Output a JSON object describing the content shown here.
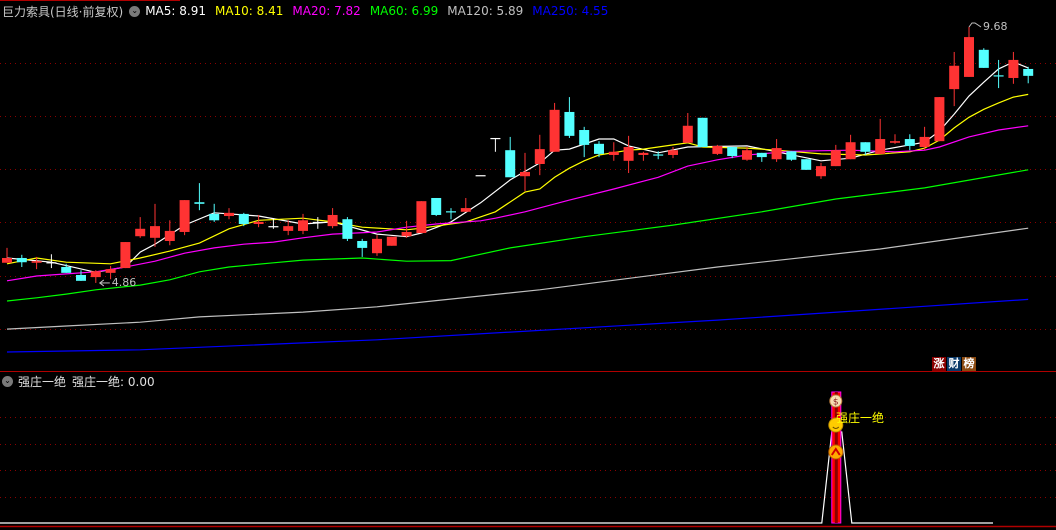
{
  "header": {
    "title": "巨力索具(日线·前复权)",
    "ma": [
      {
        "label": "MA5: 8.91",
        "color": "#ffffff"
      },
      {
        "label": "MA10: 8.41",
        "color": "#ffff00"
      },
      {
        "label": "MA20: 7.82",
        "color": "#ff00ff"
      },
      {
        "label": "MA60: 6.99",
        "color": "#00ff00"
      },
      {
        "label": "MA120: 5.89",
        "color": "#c0c0c0"
      },
      {
        "label": "MA250: 4.55",
        "color": "#0000ff"
      }
    ]
  },
  "markers": {
    "high_label": "9.68",
    "low_label": "4.86",
    "high_index": 65,
    "low_index": 6
  },
  "badges": [
    {
      "text": "涨",
      "color": "#8b0000"
    },
    {
      "text": "财",
      "color": "#0a3a6a"
    },
    {
      "text": "榜",
      "color": "#8b4a10"
    }
  ],
  "indicator": {
    "name": "强庄一绝",
    "value_label": "强庄一绝: 0.00",
    "signal_label": "强庄一绝",
    "signal_index": 56
  },
  "colors": {
    "up": "#ff3333",
    "down": "#54ffff",
    "doji": "#ffffff",
    "grid": "#8b0000",
    "panel_border": "#b00000"
  },
  "chart_data": {
    "type": "candlestick",
    "price_gridlines": [
      4,
      5,
      6,
      7,
      8,
      9
    ],
    "candles_ohlc": [
      [
        5.24,
        5.52,
        5.24,
        5.33
      ],
      [
        5.33,
        5.39,
        5.16,
        5.25
      ],
      [
        5.24,
        5.35,
        5.12,
        5.27
      ],
      [
        5.25,
        5.4,
        5.14,
        5.25
      ],
      [
        5.16,
        5.22,
        5.05,
        5.05
      ],
      [
        5.01,
        5.1,
        4.9,
        4.9
      ],
      [
        4.97,
        5.1,
        4.86,
        5.08
      ],
      [
        5.05,
        5.18,
        4.93,
        5.12
      ],
      [
        5.14,
        5.63,
        5.14,
        5.63
      ],
      [
        5.74,
        6.1,
        5.71,
        5.88
      ],
      [
        5.71,
        6.35,
        5.54,
        5.93
      ],
      [
        5.65,
        6.04,
        5.57,
        5.84
      ],
      [
        5.82,
        6.42,
        5.76,
        6.42
      ],
      [
        6.38,
        6.74,
        6.23,
        6.35
      ],
      [
        6.16,
        6.35,
        6.01,
        6.04
      ],
      [
        6.12,
        6.27,
        6.06,
        6.18
      ],
      [
        6.16,
        6.18,
        5.93,
        5.97
      ],
      [
        5.97,
        6.14,
        5.91,
        6.01
      ],
      [
        5.93,
        6.08,
        5.88,
        5.93
      ],
      [
        5.84,
        6.04,
        5.76,
        5.93
      ],
      [
        5.84,
        6.16,
        5.78,
        6.04
      ],
      [
        6.01,
        6.1,
        5.88,
        6.01
      ],
      [
        5.93,
        6.27,
        5.89,
        6.14
      ],
      [
        6.06,
        6.1,
        5.65,
        5.69
      ],
      [
        5.65,
        5.69,
        5.35,
        5.52
      ],
      [
        5.42,
        5.76,
        5.37,
        5.69
      ],
      [
        5.56,
        5.73,
        5.56,
        5.73
      ],
      [
        5.74,
        6.03,
        5.71,
        5.82
      ],
      [
        5.8,
        6.4,
        5.8,
        6.4
      ],
      [
        6.46,
        6.46,
        6.12,
        6.14
      ],
      [
        6.21,
        6.27,
        6.06,
        6.2
      ],
      [
        6.2,
        6.46,
        6.2,
        6.27
      ],
      [
        6.89,
        6.89,
        6.89,
        6.89
      ],
      [
        7.59,
        7.59,
        7.33,
        7.59
      ],
      [
        7.36,
        7.61,
        6.85,
        6.85
      ],
      [
        6.87,
        7.31,
        6.59,
        6.95
      ],
      [
        7.1,
        7.65,
        6.89,
        7.38
      ],
      [
        7.33,
        8.25,
        7.33,
        8.12
      ],
      [
        8.08,
        8.36,
        7.59,
        7.63
      ],
      [
        7.74,
        7.8,
        7.23,
        7.46
      ],
      [
        7.48,
        7.53,
        7.23,
        7.29
      ],
      [
        7.27,
        7.51,
        7.16,
        7.33
      ],
      [
        7.16,
        7.63,
        6.93,
        7.42
      ],
      [
        7.27,
        7.33,
        7.16,
        7.31
      ],
      [
        7.28,
        7.34,
        7.19,
        7.27
      ],
      [
        7.27,
        7.42,
        7.21,
        7.36
      ],
      [
        7.5,
        8.06,
        7.5,
        7.82
      ],
      [
        7.97,
        7.97,
        7.42,
        7.42
      ],
      [
        7.29,
        7.46,
        7.27,
        7.44
      ],
      [
        7.42,
        7.42,
        7.21,
        7.25
      ],
      [
        7.18,
        7.42,
        7.16,
        7.36
      ],
      [
        7.31,
        7.31,
        7.14,
        7.23
      ],
      [
        7.19,
        7.57,
        7.14,
        7.4
      ],
      [
        7.34,
        7.34,
        7.16,
        7.18
      ],
      [
        7.19,
        7.19,
        6.99,
        6.99
      ],
      [
        6.87,
        7.12,
        6.82,
        7.06
      ],
      [
        7.06,
        7.46,
        7.06,
        7.36
      ],
      [
        7.19,
        7.65,
        7.19,
        7.51
      ],
      [
        7.51,
        7.51,
        7.27,
        7.33
      ],
      [
        7.29,
        7.95,
        7.29,
        7.57
      ],
      [
        7.5,
        7.66,
        7.48,
        7.53
      ],
      [
        7.57,
        7.66,
        7.36,
        7.44
      ],
      [
        7.42,
        7.8,
        7.36,
        7.61
      ],
      [
        7.53,
        8.36,
        7.53,
        8.36
      ],
      [
        8.51,
        9.21,
        8.19,
        8.95
      ],
      [
        8.74,
        9.68,
        8.74,
        9.49
      ],
      [
        9.25,
        9.28,
        8.91,
        8.91
      ],
      [
        8.77,
        9.06,
        8.53,
        8.76
      ],
      [
        8.72,
        9.21,
        8.61,
        9.06
      ],
      [
        8.89,
        8.93,
        8.62,
        8.76
      ]
    ],
    "moving_averages": [
      {
        "name": "MA5",
        "color": "#ffffff",
        "points": [
          [
            0,
            5.33
          ],
          [
            3,
            5.25
          ],
          [
            6,
            5.06
          ],
          [
            8,
            5.16
          ],
          [
            9,
            5.44
          ],
          [
            10,
            5.59
          ],
          [
            12,
            5.95
          ],
          [
            14,
            6.18
          ],
          [
            17,
            6.12
          ],
          [
            20,
            5.97
          ],
          [
            22,
            6.01
          ],
          [
            25,
            5.78
          ],
          [
            27,
            5.73
          ],
          [
            28,
            5.8
          ],
          [
            30,
            6.01
          ],
          [
            32,
            6.37
          ],
          [
            34,
            6.8
          ],
          [
            36,
            7.12
          ],
          [
            37,
            7.36
          ],
          [
            38,
            7.38
          ],
          [
            40,
            7.57
          ],
          [
            41,
            7.57
          ],
          [
            42,
            7.44
          ],
          [
            44,
            7.31
          ],
          [
            46,
            7.42
          ],
          [
            50,
            7.44
          ],
          [
            52,
            7.33
          ],
          [
            55,
            7.16
          ],
          [
            57,
            7.21
          ],
          [
            59,
            7.36
          ],
          [
            62,
            7.51
          ],
          [
            63,
            7.72
          ],
          [
            64,
            8.04
          ],
          [
            65,
            8.38
          ],
          [
            66,
            8.64
          ],
          [
            67,
            8.89
          ],
          [
            68,
            9.02
          ],
          [
            69,
            8.91
          ]
        ]
      },
      {
        "name": "MA10",
        "color": "#ffff00",
        "points": [
          [
            0,
            5.22
          ],
          [
            2,
            5.33
          ],
          [
            4,
            5.25
          ],
          [
            7,
            5.22
          ],
          [
            9,
            5.33
          ],
          [
            11,
            5.46
          ],
          [
            13,
            5.61
          ],
          [
            15,
            5.88
          ],
          [
            17,
            6.04
          ],
          [
            20,
            6.08
          ],
          [
            22,
            6.01
          ],
          [
            24,
            5.91
          ],
          [
            27,
            5.86
          ],
          [
            28,
            5.89
          ],
          [
            31,
            6.01
          ],
          [
            33,
            6.2
          ],
          [
            35,
            6.57
          ],
          [
            36,
            6.63
          ],
          [
            37,
            6.85
          ],
          [
            38,
            7.02
          ],
          [
            39,
            7.16
          ],
          [
            40,
            7.27
          ],
          [
            42,
            7.36
          ],
          [
            43,
            7.38
          ],
          [
            45,
            7.46
          ],
          [
            46,
            7.5
          ],
          [
            47,
            7.42
          ],
          [
            50,
            7.4
          ],
          [
            52,
            7.36
          ],
          [
            55,
            7.29
          ],
          [
            58,
            7.27
          ],
          [
            61,
            7.33
          ],
          [
            62,
            7.4
          ],
          [
            63,
            7.55
          ],
          [
            64,
            7.78
          ],
          [
            65,
            7.98
          ],
          [
            66,
            8.13
          ],
          [
            67,
            8.25
          ],
          [
            68,
            8.36
          ],
          [
            69,
            8.41
          ]
        ]
      },
      {
        "name": "MA20",
        "color": "#ff00ff",
        "points": [
          [
            0,
            4.9
          ],
          [
            2,
            4.99
          ],
          [
            4,
            5.03
          ],
          [
            6,
            5.07
          ],
          [
            8,
            5.16
          ],
          [
            10,
            5.27
          ],
          [
            12,
            5.42
          ],
          [
            14,
            5.52
          ],
          [
            16,
            5.59
          ],
          [
            18,
            5.63
          ],
          [
            20,
            5.71
          ],
          [
            22,
            5.78
          ],
          [
            25,
            5.82
          ],
          [
            27,
            5.91
          ],
          [
            29,
            5.97
          ],
          [
            32,
            6.03
          ],
          [
            33,
            6.08
          ],
          [
            35,
            6.2
          ],
          [
            38,
            6.42
          ],
          [
            41,
            6.63
          ],
          [
            44,
            6.85
          ],
          [
            46,
            7.06
          ],
          [
            48,
            7.18
          ],
          [
            50,
            7.27
          ],
          [
            53,
            7.34
          ],
          [
            57,
            7.36
          ],
          [
            60,
            7.33
          ],
          [
            62,
            7.36
          ],
          [
            63,
            7.42
          ],
          [
            65,
            7.61
          ],
          [
            67,
            7.74
          ],
          [
            69,
            7.82
          ]
        ]
      },
      {
        "name": "MA60",
        "color": "#00ff00",
        "points": [
          [
            0,
            4.52
          ],
          [
            2,
            4.58
          ],
          [
            4,
            4.65
          ],
          [
            6,
            4.73
          ],
          [
            9,
            4.82
          ],
          [
            11,
            4.92
          ],
          [
            13,
            5.07
          ],
          [
            15,
            5.16
          ],
          [
            18,
            5.24
          ],
          [
            20,
            5.29
          ],
          [
            24,
            5.33
          ],
          [
            27,
            5.27
          ],
          [
            30,
            5.28
          ],
          [
            34,
            5.52
          ],
          [
            39,
            5.73
          ],
          [
            45,
            5.95
          ],
          [
            51,
            6.2
          ],
          [
            56,
            6.44
          ],
          [
            62,
            6.65
          ],
          [
            69,
            6.99
          ]
        ]
      },
      {
        "name": "MA120",
        "color": "#c0c0c0",
        "points": [
          [
            0,
            3.99
          ],
          [
            4,
            4.05
          ],
          [
            9,
            4.12
          ],
          [
            13,
            4.22
          ],
          [
            20,
            4.31
          ],
          [
            25,
            4.41
          ],
          [
            36,
            4.73
          ],
          [
            48,
            5.16
          ],
          [
            59,
            5.5
          ],
          [
            69,
            5.89
          ]
        ]
      },
      {
        "name": "MA250",
        "color": "#0000ff",
        "points": [
          [
            0,
            3.56
          ],
          [
            9,
            3.6
          ],
          [
            20,
            3.73
          ],
          [
            25,
            3.79
          ],
          [
            48,
            4.16
          ],
          [
            69,
            4.55
          ]
        ]
      }
    ]
  }
}
